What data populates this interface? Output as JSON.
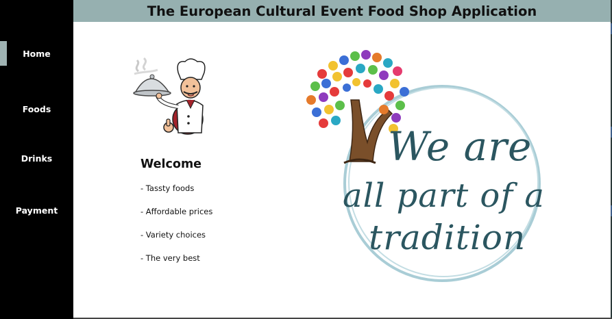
{
  "app": {
    "title": "The European Cultural Event Food Shop Application"
  },
  "sidebar": {
    "items": [
      {
        "label": "Home",
        "active": true
      },
      {
        "label": "Foods",
        "active": false
      },
      {
        "label": "Drinks",
        "active": false
      },
      {
        "label": "Payment",
        "active": false
      }
    ]
  },
  "main": {
    "welcome": {
      "title": "Welcome",
      "features": [
        "- Tassty foods",
        "- Affordable prices",
        "- Variety choices",
        "- The very best"
      ]
    },
    "images": {
      "chef_icon": "chef-with-cloche-icon",
      "tradition_logo": {
        "icon": "handprint-tree-icon",
        "lines": [
          "We are",
          "all part of a",
          "tradition"
        ]
      }
    }
  },
  "colors": {
    "sidebar_bg": "#000000",
    "header_bg": "#96b0b0",
    "active_marker": "#9fb3b3",
    "script_text": "#2b5660",
    "circle_stroke": "#a9cdd6"
  }
}
